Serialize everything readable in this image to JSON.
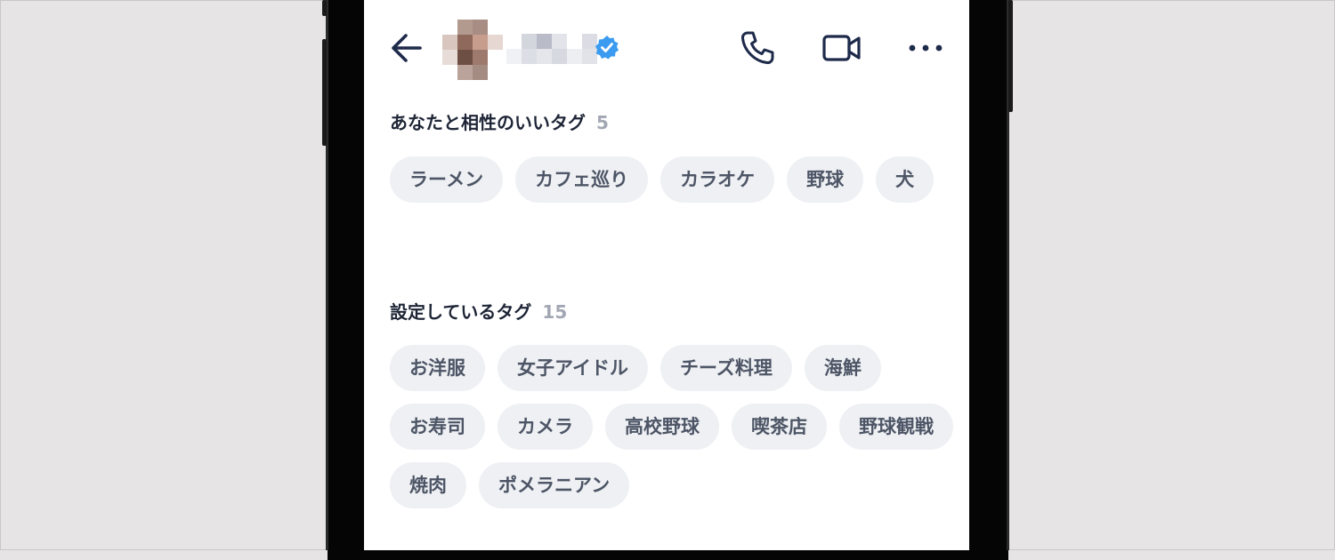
{
  "header": {
    "back_icon": "arrow-left-icon",
    "verified_icon": "verified-badge-icon",
    "verified_color": "#3b9bf0",
    "call_icon": "phone-icon",
    "video_icon": "video-camera-icon",
    "more_icon": "more-horizontal-icon"
  },
  "compatible_tags": {
    "title": "あなたと相性のいいタグ",
    "count": "5",
    "tags": [
      "ラーメン",
      "カフェ巡り",
      "カラオケ",
      "野球",
      "犬"
    ]
  },
  "my_tags": {
    "title": "設定しているタグ",
    "count": "15",
    "tags": [
      "お洋服",
      "女子アイドル",
      "チーズ料理",
      "海鮮",
      "お寿司",
      "カメラ",
      "高校野球",
      "喫茶店",
      "野球観戦",
      "焼肉",
      "ポメラニアン"
    ]
  },
  "colors": {
    "chip_bg": "#eef0f3",
    "chip_text": "#4d5566",
    "title_text": "#1e2536",
    "count_text": "#a2a7b3",
    "icon_dark": "#1e2a4a"
  }
}
